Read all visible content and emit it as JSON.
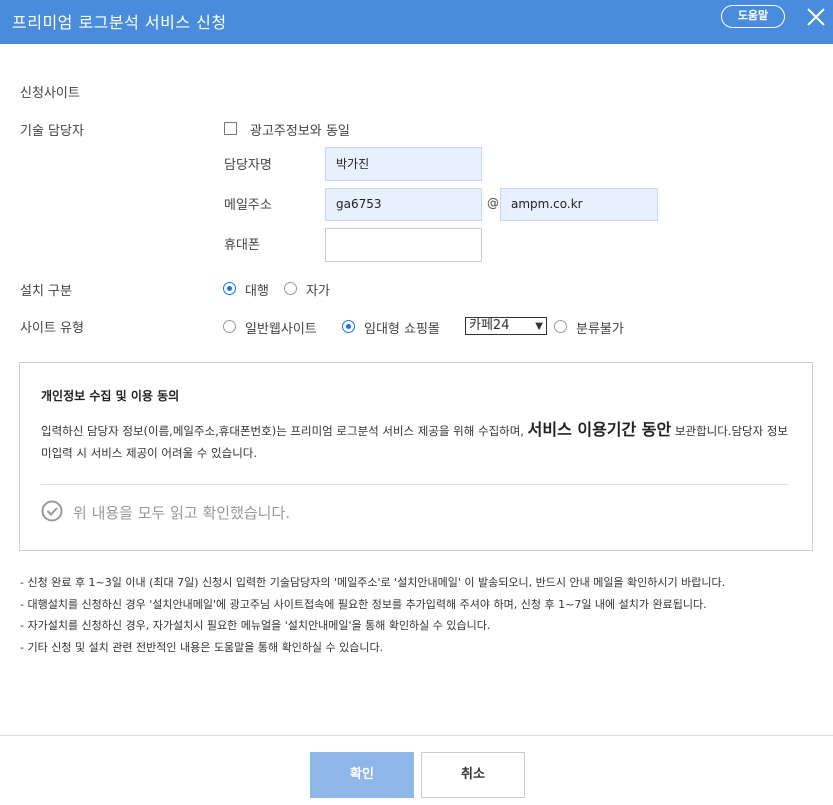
{
  "header": {
    "title": "프리미엄 로그분석 서비스 신청",
    "help_label": "도움말"
  },
  "form": {
    "site_label": "신청사이트",
    "site_value": "",
    "tech_contact_label": "기술 담당자",
    "same_as_advertiser_label": "광고주정보와 동일",
    "same_as_advertiser_checked": false,
    "name_label": "담당자명",
    "name_value": "박가진",
    "email_label": "메일주소",
    "email_id": "ga6753",
    "email_at": "@",
    "email_domain": "ampm.co.kr",
    "phone_label": "휴대폰",
    "phone_value": "",
    "install_type_label": "설치 구분",
    "install_options": [
      "대행",
      "자가"
    ],
    "install_selected": "대행",
    "site_type_label": "사이트 유형",
    "site_type_options": [
      "일반웹사이트",
      "임대형 쇼핑몰",
      "분류불가"
    ],
    "site_type_selected": "임대형 쇼핑몰",
    "mall_select_value": "카페24"
  },
  "consent": {
    "title": "개인정보 수집 및 이용 동의",
    "body_part1": "입력하신 담당자 정보(이름,메일주소,휴대폰번호)는 프리미엄 로그분석 서비스 제공을 위해 수집하며, ",
    "body_highlight": "서비스 이용기간 동안",
    "body_part2": " 보관합니다.담당자 정보 미입력 시 서비스 제공이 어려울 수 있습니다.",
    "confirm_label": "위 내용을 모두 읽고 확인했습니다."
  },
  "notes": [
    "- 신청 완료 후 1~3일 이내 (최대 7일) 신청시 입력한 기술담당자의 '메일주소'로 '설치안내메일' 이 발송되오니, 반드시 안내 메일을 확인하시기 바랍니다.",
    "- 대행설치를 신청하신 경우 '설치안내메일'에 광고주님 사이트접속에 필요한 정보를 추가입력해 주셔야 하며, 신청 후 1~7일 내에 설치가 완료됩니다.",
    "- 자가설치를 신청하신 경우, 자가설치시 필요한 메뉴얼을 '설치안내메일'을 통해 확인하실 수 있습니다.",
    "- 기타 신청 및 설치 관련 전반적인 내용은 도움말을 통해 확인하실 수 있습니다."
  ],
  "footer": {
    "ok_label": "확인",
    "cancel_label": "취소"
  },
  "colors": {
    "titlebar": "#4a8cdc",
    "accent": "#1a73e8",
    "ok_button": "#8fb6e8",
    "filled_input": "#e8f0fe"
  }
}
